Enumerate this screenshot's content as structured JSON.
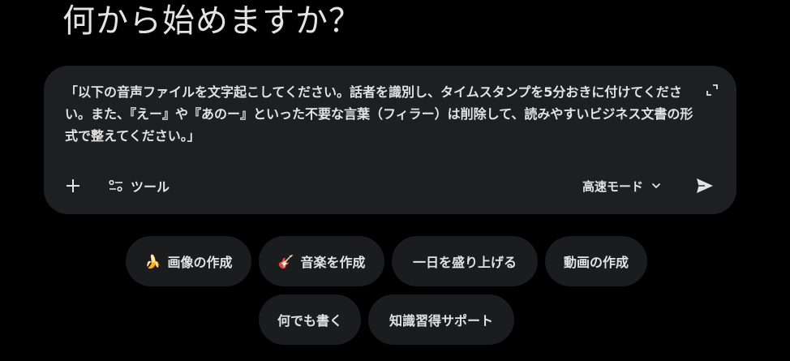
{
  "heading": "何から始めますか？",
  "composer": {
    "prompt": "「以下の音声ファイルを文字起こしてください。話者を識別し、タイムスタンプを5分おきに付けてください。また、『えー』や『あのー』といった不要な言葉（フィラー）は削除して、読みやすいビジネス文書の形式で整えてください。」",
    "tools_label": "ツール",
    "mode_label": "高速モード"
  },
  "chips": [
    {
      "emoji": "🍌",
      "label": "画像の作成"
    },
    {
      "emoji": "🎸",
      "label": "音楽を作成"
    },
    {
      "emoji": "",
      "label": "一日を盛り上げる"
    },
    {
      "emoji": "",
      "label": "動画の作成"
    },
    {
      "emoji": "",
      "label": "何でも書く"
    },
    {
      "emoji": "",
      "label": "知識習得サポート"
    }
  ],
  "colors": {
    "background": "#000000",
    "surface": "#1e1f20",
    "chip": "#1b1c1d",
    "text": "#e3e3e3"
  }
}
